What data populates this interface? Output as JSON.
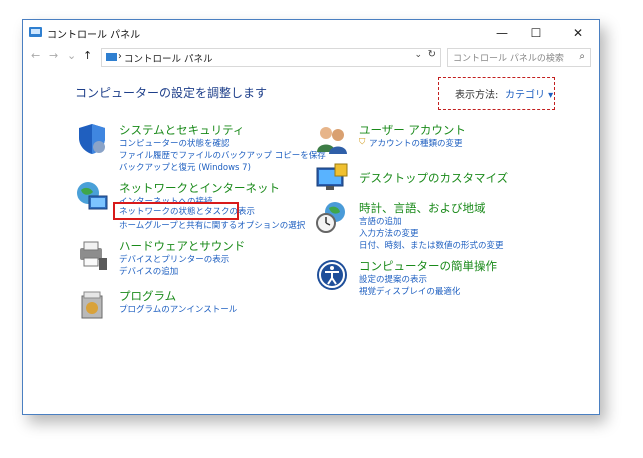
{
  "window": {
    "title": "コントロール パネル",
    "minimize": "—",
    "maximize": "☐",
    "close": "✕"
  },
  "nav": {
    "back": "←",
    "forward": "→",
    "dropdown": "⌄",
    "up": "↑"
  },
  "address": {
    "separator": "›",
    "path": "コントロール パネル",
    "dropdown": "⌄",
    "refresh": "↻"
  },
  "search": {
    "placeholder": "コントロール パネルの検索",
    "icon": "⌕"
  },
  "main": {
    "heading": "コンピューターの設定を調整します"
  },
  "viewby": {
    "label": "表示方法:",
    "value": "カテゴリ ▾"
  },
  "categories_left": [
    {
      "title": "システムとセキュリティ",
      "links": [
        "コンピューターの状態を確認",
        "ファイル履歴でファイルのバックアップ コピーを保存",
        "バックアップと復元 (Windows 7)"
      ]
    },
    {
      "title": "ネットワークとインターネット",
      "links": [
        "インターネットへの接続",
        "ネットワークの状態とタスクの表示",
        "ホームグループと共有に関するオプションの選択"
      ]
    },
    {
      "title": "ハードウェアとサウンド",
      "links": [
        "デバイスとプリンターの表示",
        "デバイスの追加"
      ]
    },
    {
      "title": "プログラム",
      "links": [
        "プログラムのアンインストール"
      ]
    }
  ],
  "categories_right": [
    {
      "title": "ユーザー アカウント",
      "links": [
        "アカウントの種類の変更"
      ]
    },
    {
      "title": "デスクトップのカスタマイズ",
      "links": []
    },
    {
      "title": "時計、言語、および地域",
      "links": [
        "言語の追加",
        "入力方法の変更",
        "日付、時刻、または数値の形式の変更"
      ]
    },
    {
      "title": "コンピューターの簡単操作",
      "links": [
        "設定の提案の表示",
        "視覚ディスプレイの最適化"
      ]
    }
  ]
}
